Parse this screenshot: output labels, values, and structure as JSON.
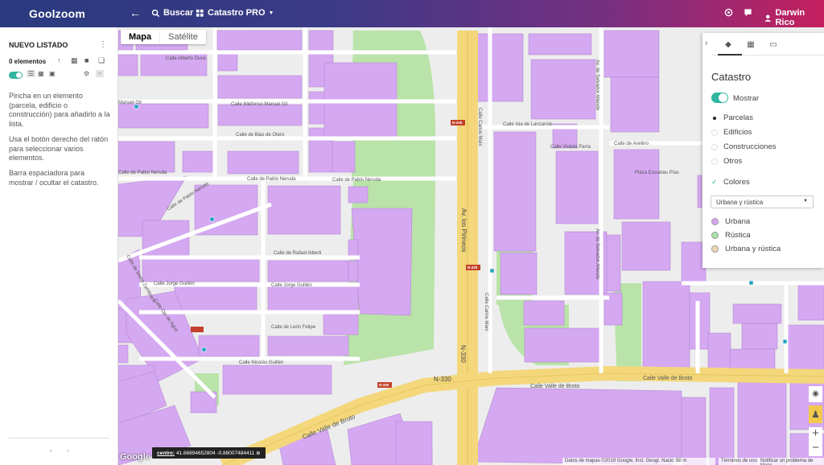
{
  "header": {
    "logo": "Goolzoom",
    "search_label": "Buscar",
    "product_label": "Catastro PRO",
    "user_name": "Darwin Rico"
  },
  "listado": {
    "title": "NUEVO LISTADO",
    "count": "0 elementos",
    "hints": [
      "Pincha en un elemento (parcela, edificio o construcción) para añadirlo a la lista.",
      "Usa el botón derecho del ratón para seleccionar varios elementos.",
      "Barra espaciadora para mostrar / ocultar el catastro."
    ]
  },
  "map": {
    "type_buttons": {
      "map": "Mapa",
      "satellite": "Satélite"
    },
    "coords": {
      "label": "centro:",
      "value": "41.66894652804 -0.88007484411"
    },
    "attribution": "Datos de mapas ©2019 Google, Inst. Geogr. Nacional",
    "scale": "50 m",
    "terms": "Términos de uso",
    "report": "Notificar un problema de Maps",
    "google_logo": "Google",
    "streets": {
      "alberto_duce": "Calle Alberto Duce",
      "manuel_gil_left": "Manuel Gil",
      "manuel_gil": "Calle Ildefonso Manuel Gil",
      "blas_de_otero": "Calle de Blas de Otero",
      "pablo_neruda_left": "Calle de Pablo Neruda",
      "pablo_neruda_right": "Calle de Pablo Neruda",
      "pablo_neruda_diag": "Calle de Pablo Neruda",
      "rafael_alberti": "Calle de Rafael Alberti",
      "jorge_guillen_left": "Calle Jorge Guillén",
      "jorge_guillen_right": "Calle Jorge Guillén",
      "leon_felipe": "Calle de León Felipe",
      "nicolas_guillen": "Calle Nicolás Guillén",
      "valle_de_broto": "Calle Valle de Broto",
      "valle_de_broto_mid": "Calle Valle de Broto",
      "valle_de_broto_right": "Calle Valle de Broto",
      "isla_de_lanzarote": "Calle Isla de Lanzarote",
      "pirineos": "Av. los Pirineos",
      "carlos_marx": "Calle Carlos Marx",
      "carlos_marx_low": "Calle Carlos Marx",
      "salvador_allende": "Av. de Salvador Allende",
      "salvador_allende_low": "Av. de Salvador Allende",
      "violeta_parra": "Calle Violeta Parra",
      "avelino": "Calle de Avelino",
      "mara_zambrano": "Calle de María Zambrano",
      "pablo_neruda_sw": "Calle de Pablo Neruda",
      "ojo_de_agua": "Calle Ojo de Agua",
      "plaza_escuelas": "Plaza Escuelas Pías",
      "n330_label": "N-330",
      "n330_shield": "N-330"
    }
  },
  "catastro_panel": {
    "title": "Catastro",
    "show_label": "Mostrar",
    "layers": [
      "Parcelas",
      "Edificios",
      "Construcciones",
      "Otros"
    ],
    "selected_layer": "Parcelas",
    "colors_label": "Colores",
    "color_mode": "Urbana y rústica",
    "legend": [
      {
        "label": "Urbana",
        "color": "#d7a6f0"
      },
      {
        "label": "Rústica",
        "color": "#a8e6a8"
      },
      {
        "label": "Urbana y rústica",
        "color": "#f0d6b0"
      }
    ]
  },
  "colors": {
    "parcel": "#d5a8f2",
    "green": "#b9e3a8",
    "highway": "#f3d77a",
    "accent": "#2fb5a0"
  }
}
